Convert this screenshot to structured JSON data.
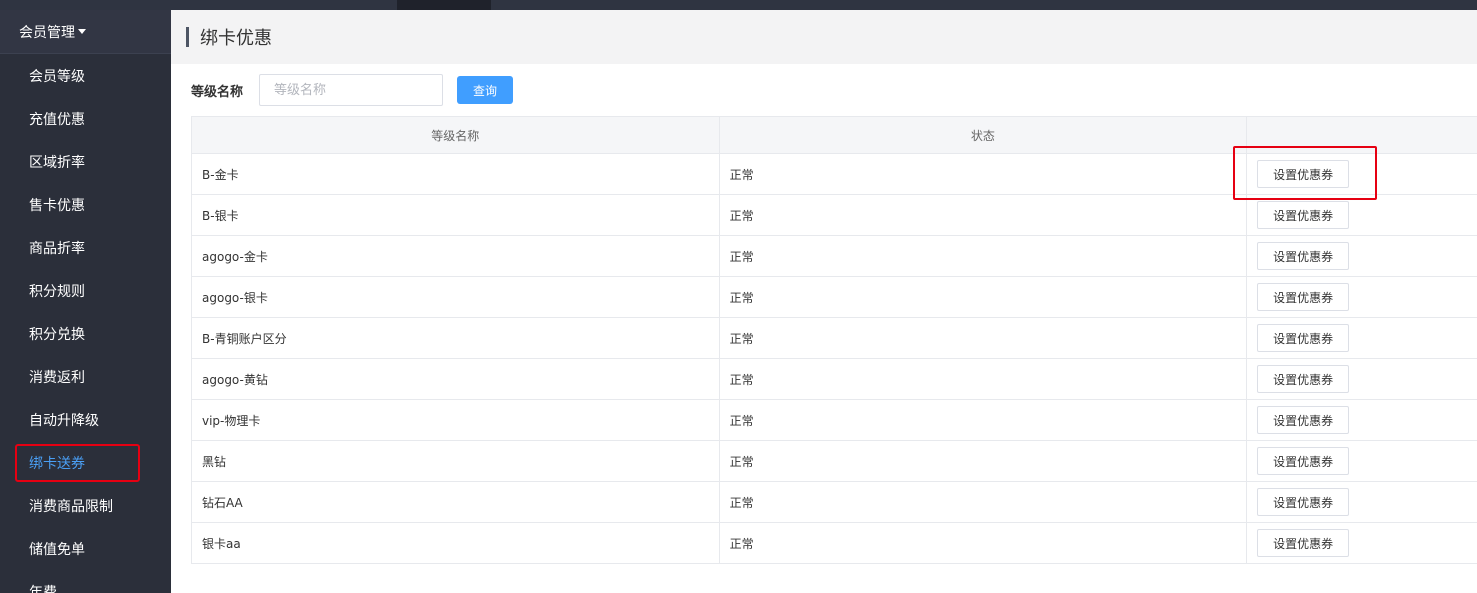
{
  "sidebar": {
    "group_label": "会员管理",
    "items": [
      {
        "label": "会员等级"
      },
      {
        "label": "充值优惠"
      },
      {
        "label": "区域折率"
      },
      {
        "label": "售卡优惠"
      },
      {
        "label": "商品折率"
      },
      {
        "label": "积分规则"
      },
      {
        "label": "积分兑换"
      },
      {
        "label": "消费返利"
      },
      {
        "label": "自动升降级"
      },
      {
        "label": "绑卡送券"
      },
      {
        "label": "消费商品限制"
      },
      {
        "label": "储值免单"
      },
      {
        "label": "年费"
      }
    ],
    "active_label": "绑卡送券"
  },
  "header": {
    "title": "绑卡优惠"
  },
  "search": {
    "label": "等级名称",
    "placeholder": "等级名称",
    "button_label": "查询"
  },
  "table": {
    "columns": [
      "等级名称",
      "状态",
      ""
    ],
    "action_label": "设置优惠券",
    "rows": [
      {
        "name": "B-金卡",
        "status": "正常"
      },
      {
        "name": "B-银卡",
        "status": "正常"
      },
      {
        "name": "agogo-金卡",
        "status": "正常"
      },
      {
        "name": "agogo-银卡",
        "status": "正常"
      },
      {
        "name": "B-青铜账户区分",
        "status": "正常"
      },
      {
        "name": "agogo-黄钻",
        "status": "正常"
      },
      {
        "name": "vip-物理卡",
        "status": "正常"
      },
      {
        "name": "黑钻",
        "status": "正常"
      },
      {
        "name": "钻石AA",
        "status": "正常"
      },
      {
        "name": "银卡aa",
        "status": "正常"
      }
    ]
  },
  "colors": {
    "sidebar_bg": "#2b2f3a",
    "active_text": "#4a9ff5",
    "primary_button": "#409eff",
    "highlight_border": "#e60012"
  }
}
